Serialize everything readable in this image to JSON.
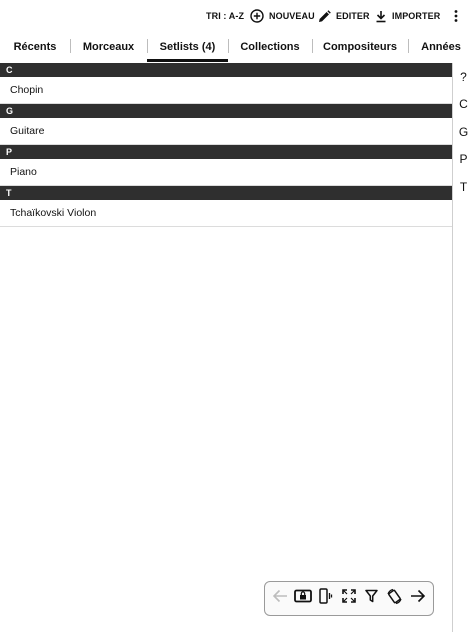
{
  "toolbar": {
    "sort_label": "TRI : A-Z",
    "new_label": "NOUVEAU",
    "edit_label": "EDITER",
    "import_label": "IMPORTER"
  },
  "tabs": [
    {
      "label": "Récents",
      "active": false
    },
    {
      "label": "Morceaux",
      "active": false
    },
    {
      "label": "Setlists (4)",
      "active": true
    },
    {
      "label": "Collections",
      "active": false
    },
    {
      "label": "Compositeurs",
      "active": false
    },
    {
      "label": "Années",
      "active": false
    }
  ],
  "sections": [
    {
      "letter": "C",
      "items": [
        "Chopin"
      ]
    },
    {
      "letter": "G",
      "items": [
        "Guitare"
      ]
    },
    {
      "letter": "P",
      "items": [
        "Piano"
      ]
    },
    {
      "letter": "T",
      "items": [
        "Tchaïkovski Violon"
      ]
    }
  ],
  "index_letters": [
    "?",
    "C",
    "G",
    "P",
    "T"
  ],
  "bottom_tools": [
    "arrow-left-icon",
    "keyboard-lock-icon",
    "phone-rotate-icon",
    "fullscreen-icon",
    "filter-icon",
    "screen-rotation-icon",
    "arrow-right-icon"
  ],
  "colors": {
    "section_header_bg": "#2f2f2f",
    "active_tab_indicator": "#111111",
    "disabled_icon": "#bdbdbd"
  }
}
